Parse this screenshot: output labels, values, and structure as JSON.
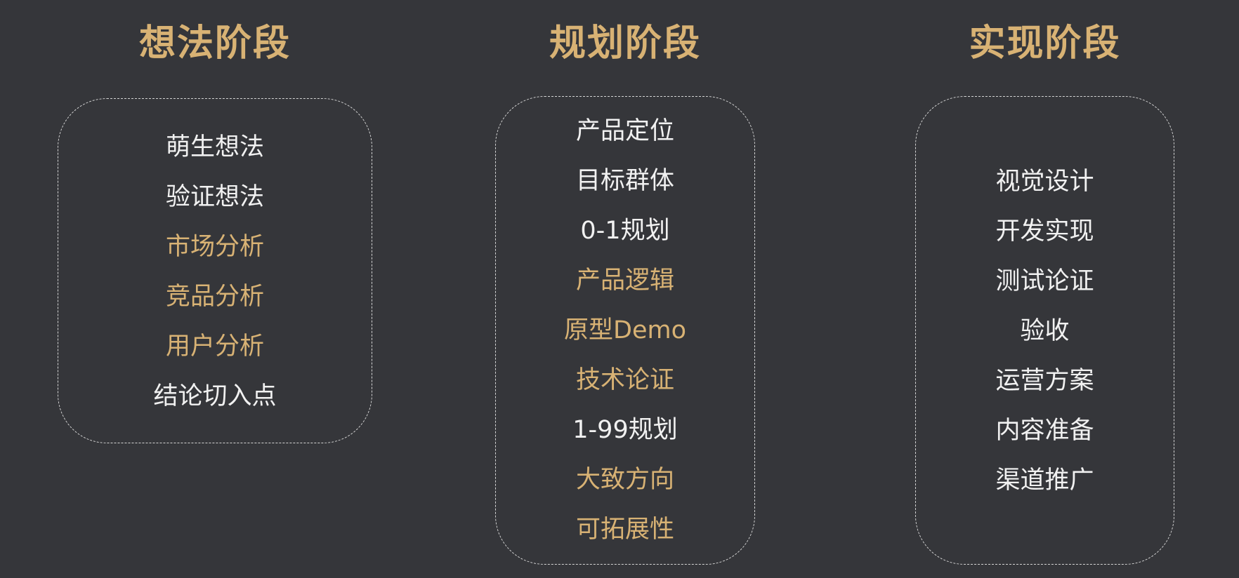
{
  "colors": {
    "background": "#35363a",
    "accent_gold": "#d8b274",
    "text_white": "#f1f1f1",
    "dashed_border": "#d4d4d4"
  },
  "stages": [
    {
      "title": "想法阶段",
      "items": [
        {
          "label": "萌生想法",
          "highlight": false
        },
        {
          "label": "验证想法",
          "highlight": false
        },
        {
          "label": "市场分析",
          "highlight": true
        },
        {
          "label": "竞品分析",
          "highlight": true
        },
        {
          "label": "用户分析",
          "highlight": true
        },
        {
          "label": "结论切入点",
          "highlight": false
        }
      ]
    },
    {
      "title": "规划阶段",
      "items": [
        {
          "label": "产品定位",
          "highlight": false
        },
        {
          "label": "目标群体",
          "highlight": false
        },
        {
          "label": "0-1规划",
          "highlight": false
        },
        {
          "label": "产品逻辑",
          "highlight": true
        },
        {
          "label": "原型Demo",
          "highlight": true
        },
        {
          "label": "技术论证",
          "highlight": true
        },
        {
          "label": "1-99规划",
          "highlight": false
        },
        {
          "label": "大致方向",
          "highlight": true
        },
        {
          "label": "可拓展性",
          "highlight": true
        }
      ]
    },
    {
      "title": "实现阶段",
      "items": [
        {
          "label": "视觉设计",
          "highlight": false
        },
        {
          "label": "开发实现",
          "highlight": false
        },
        {
          "label": "测试论证",
          "highlight": false
        },
        {
          "label": "验收",
          "highlight": false
        },
        {
          "label": "运营方案",
          "highlight": false
        },
        {
          "label": "内容准备",
          "highlight": false
        },
        {
          "label": "渠道推广",
          "highlight": false
        }
      ]
    }
  ]
}
